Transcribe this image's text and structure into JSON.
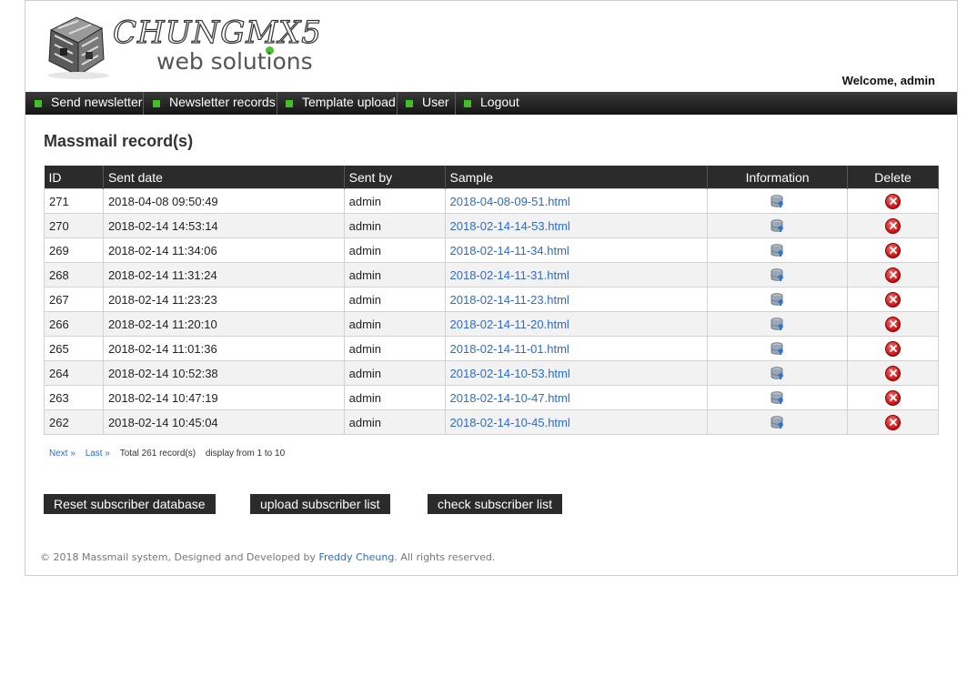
{
  "brand": {
    "name": "CHUNGMX5",
    "tagline": "web solutions"
  },
  "welcome": "Welcome, admin",
  "nav": [
    {
      "label": "Send newsletter"
    },
    {
      "label": "Newsletter records"
    },
    {
      "label": "Template upload"
    },
    {
      "label": "User"
    },
    {
      "label": "Logout"
    }
  ],
  "page_title": "Massmail record(s)",
  "table": {
    "headers": [
      "ID",
      "Sent date",
      "Sent by",
      "Sample",
      "Information",
      "Delete"
    ],
    "rows": [
      {
        "id": "271",
        "date": "2018-04-08 09:50:49",
        "by": "admin",
        "sample": "2018-04-08-09-51.html"
      },
      {
        "id": "270",
        "date": "2018-02-14 14:53:14",
        "by": "admin",
        "sample": "2018-02-14-14-53.html"
      },
      {
        "id": "269",
        "date": "2018-02-14 11:34:06",
        "by": "admin",
        "sample": "2018-02-14-11-34.html"
      },
      {
        "id": "268",
        "date": "2018-02-14 11:31:24",
        "by": "admin",
        "sample": "2018-02-14-11-31.html"
      },
      {
        "id": "267",
        "date": "2018-02-14 11:23:23",
        "by": "admin",
        "sample": "2018-02-14-11-23.html"
      },
      {
        "id": "266",
        "date": "2018-02-14 11:20:10",
        "by": "admin",
        "sample": "2018-02-14-11-20.html"
      },
      {
        "id": "265",
        "date": "2018-02-14 11:01:36",
        "by": "admin",
        "sample": "2018-02-14-11-01.html"
      },
      {
        "id": "264",
        "date": "2018-02-14 10:52:38",
        "by": "admin",
        "sample": "2018-02-14-10-53.html"
      },
      {
        "id": "263",
        "date": "2018-02-14 10:47:19",
        "by": "admin",
        "sample": "2018-02-14-10-47.html"
      },
      {
        "id": "262",
        "date": "2018-02-14 10:45:04",
        "by": "admin",
        "sample": "2018-02-14-10-45.html"
      }
    ]
  },
  "pager": {
    "next": "Next »",
    "last": "Last »",
    "total": "Total 261 record(s)",
    "display": "display from 1 to 10"
  },
  "buttons": {
    "reset": "Reset subscriber database",
    "upload": "upload subscriber list",
    "check": "check subscriber list"
  },
  "footer": {
    "prefix": "© 2018 Massmail system, Designed and Developed by",
    "author": "Freddy Cheung",
    "suffix": ". All rights reserved."
  },
  "colors": {
    "nav_bg": "#2b2b2b",
    "nav_bullet": "#3fc125",
    "link": "#2d6bd1",
    "delete": "#c41010"
  },
  "icons": {
    "info": "database-upload-icon",
    "delete": "delete-x-icon"
  }
}
